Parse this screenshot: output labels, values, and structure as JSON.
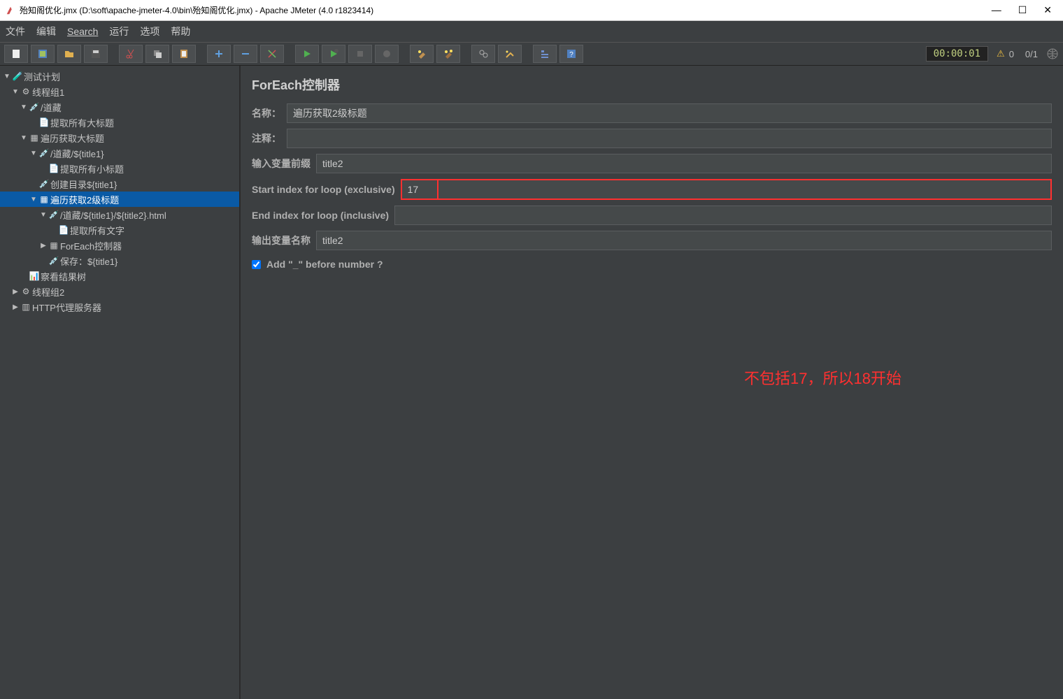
{
  "window": {
    "title": "殆知阁优化.jmx (D:\\soft\\apache-jmeter-4.0\\bin\\殆知阁优化.jmx) - Apache JMeter (4.0 r1823414)"
  },
  "menu": {
    "file": "文件",
    "edit": "编辑",
    "search": "Search",
    "run": "运行",
    "options": "选项",
    "help": "帮助"
  },
  "status": {
    "timer": "00:00:01",
    "warnings": "0",
    "threads": "0/1"
  },
  "tree": {
    "n0": "测试计划",
    "n1": "线程组1",
    "n2": "/道藏",
    "n3": "提取所有大标题",
    "n4": "遍历获取大标题",
    "n5": "/道藏/${title1}",
    "n6": "提取所有小标题",
    "n7": "创建目录${title1}",
    "n8": "遍历获取2级标题",
    "n9": "/道藏/${title1}/${title2}.html",
    "n10": "提取所有文字",
    "n11": "ForEach控制器",
    "n12": "保存：${title1}",
    "n13": "察看结果树",
    "n14": "线程组2",
    "n15": "HTTP代理服务器"
  },
  "panel": {
    "heading": "ForEach控制器",
    "name_label": "名称：",
    "name_value": "遍历获取2级标题",
    "comment_label": "注释：",
    "comment_value": "",
    "prefix_label": "输入变量前缀",
    "prefix_value": "title2",
    "start_label": "Start index for loop (exclusive)",
    "start_value": "17",
    "end_label": "End index for loop (inclusive)",
    "end_value": "",
    "out_label": "输出变量名称",
    "out_value": "title2",
    "check_label": "Add \"_\" before number ?"
  },
  "annotation": "不包括17，所以18开始"
}
